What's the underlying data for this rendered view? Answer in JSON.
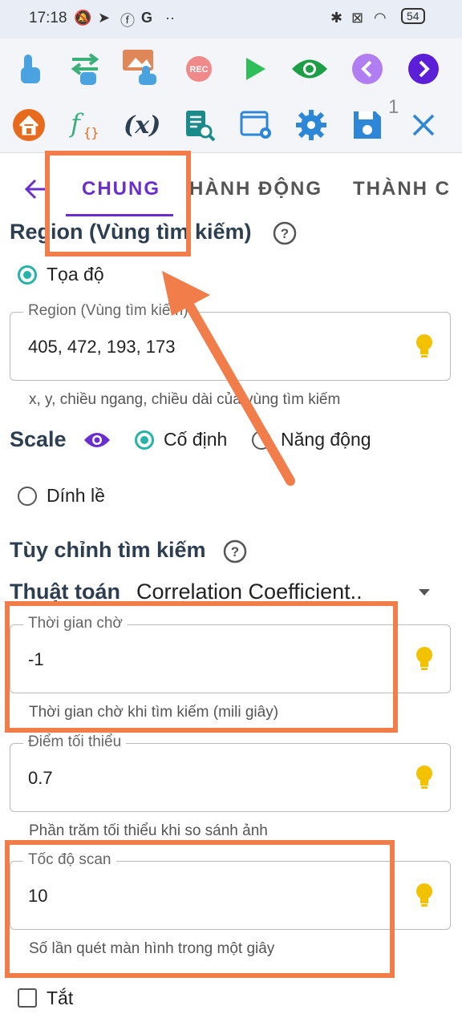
{
  "status": {
    "time": "17:18",
    "battery": "54"
  },
  "toolbar": {
    "page_num": "1"
  },
  "tabs": [
    "CHUNG",
    "HÀNH ĐỘNG",
    "THÀNH C"
  ],
  "region": {
    "title": "Region (Vùng tìm kiếm)",
    "radio_label": "Tọa độ",
    "field_label": "Region (Vùng tìm kiếm)",
    "field_value": "405, 472, 193, 173",
    "helper": "x, y, chiều ngang, chiều dài của vùng tìm kiếm"
  },
  "scale": {
    "title": "Scale",
    "options": [
      "Cố định",
      "Năng động",
      "Dính lề"
    ],
    "selected": "Cố định"
  },
  "search": {
    "title": "Tùy chỉnh tìm kiếm",
    "algo_label": "Thuật toán",
    "algo_value": "Correlation Coefficient.."
  },
  "fields": [
    {
      "label": "Thời gian chờ",
      "value": "-1",
      "helper": "Thời gian chờ khi tìm kiếm (mili giây)"
    },
    {
      "label": "Điểm tối thiểu",
      "value": "0.7",
      "helper": "Phần trăm tối thiểu khi so sánh ảnh"
    },
    {
      "label": "Tốc độ scan",
      "value": "10",
      "helper": "Số lần quét màn hình trong một giây"
    }
  ],
  "off_checkbox": "Tắt",
  "colors": {
    "accent": "#6a2ecf",
    "teal": "#26b3a8",
    "highlight": "#f07d4a",
    "bulb": "#f2c200"
  }
}
